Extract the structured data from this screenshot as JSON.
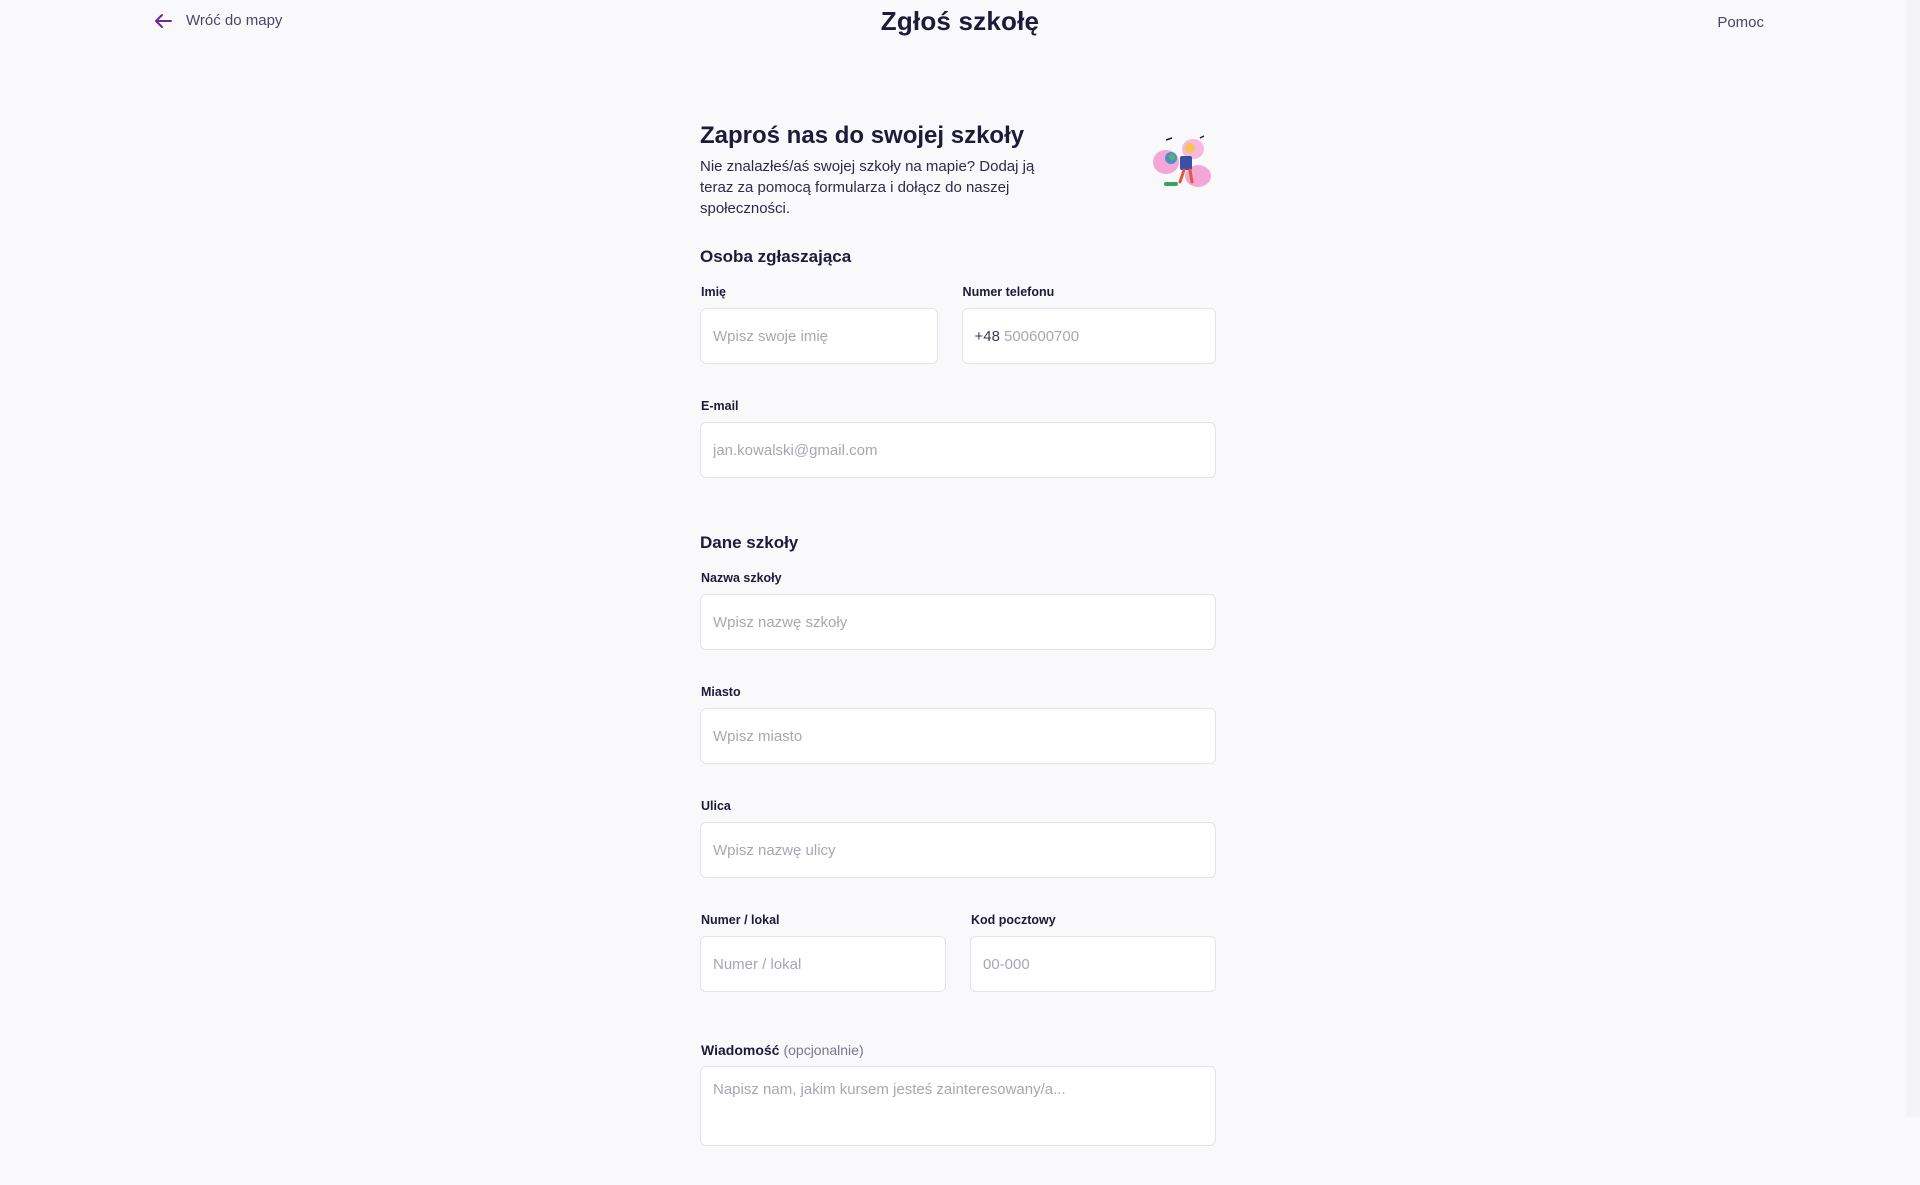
{
  "header": {
    "back_label": "Wróć do mapy",
    "title": "Zgłoś szkołę",
    "help_label": "Pomoc"
  },
  "intro": {
    "title": "Zaproś nas do swojej szkoły",
    "text": "Nie znalazłeś/aś swojej szkoły na mapie? Dodaj ją teraz za pomocą formularza i dołącz do naszej społeczności."
  },
  "reporter": {
    "section_title": "Osoba zgłaszająca",
    "name_label": "Imię",
    "name_placeholder": "Wpisz swoje imię",
    "phone_label": "Numer telefonu",
    "phone_prefix": "+48",
    "phone_placeholder": "500600700",
    "email_label": "E-mail",
    "email_placeholder": "jan.kowalski@gmail.com"
  },
  "school": {
    "section_title": "Dane szkoły",
    "name_label": "Nazwa szkoły",
    "name_placeholder": "Wpisz nazwę szkoły",
    "city_label": "Miasto",
    "city_placeholder": "Wpisz miasto",
    "street_label": "Ulica",
    "street_placeholder": "Wpisz nazwę ulicy",
    "number_label": "Numer / lokal",
    "number_placeholder": "Numer / lokal",
    "postal_label": "Kod pocztowy",
    "postal_placeholder": "00-000"
  },
  "message": {
    "label": "Wiadomość",
    "optional": "(opcjonalnie)",
    "placeholder": "Napisz nam, jakim kursem jesteś zainteresowany/a..."
  },
  "icons": {
    "back": "arrow-left-icon",
    "illustration": "school-illustration"
  },
  "colors": {
    "accent": "#6b2d8a",
    "background": "#f9f8fb",
    "text": "#1c1b3a"
  }
}
